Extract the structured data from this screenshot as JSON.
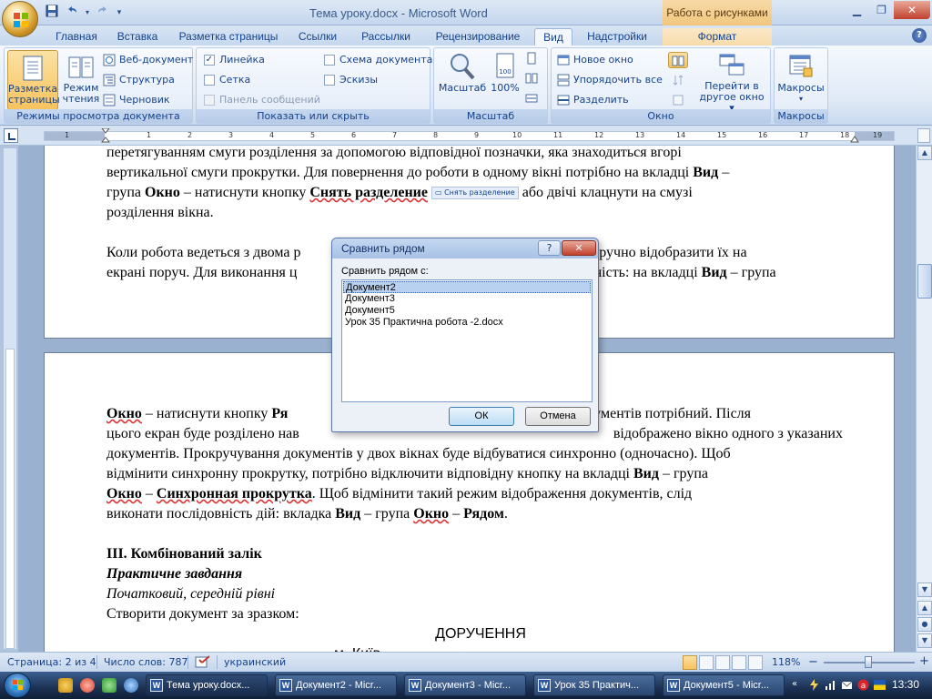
{
  "window": {
    "title": "Тема уроку.docx - Microsoft Word",
    "context_tab_title": "Работа с рисунками"
  },
  "tabs": [
    "Главная",
    "Вставка",
    "Разметка страницы",
    "Ссылки",
    "Рассылки",
    "Рецензирование",
    "Вид",
    "Надстройки",
    "Формат"
  ],
  "active_tab": "Вид",
  "ribbon": {
    "groups": {
      "views": {
        "label": "Режимы просмотра документа",
        "print_layout": "Разметка\nстраницы",
        "print_layout_l1": "Разметка",
        "print_layout_l2": "страницы",
        "reading_l1": "Режим",
        "reading_l2": "чтения",
        "web": "Веб-документ",
        "outline": "Структура",
        "draft": "Черновик"
      },
      "show_hide": {
        "label": "Показать или скрыть",
        "ruler": "Линейка",
        "ruler_checked": true,
        "doc_map": "Схема документа",
        "grid": "Сетка",
        "thumbnails": "Эскизы",
        "message_bar": "Панель сообщений"
      },
      "zoom": {
        "label": "Масштаб",
        "zoom": "Масштаб",
        "percent": "100%",
        "percent_icon": "100"
      },
      "window": {
        "label": "Окно",
        "new_window": "Новое окно",
        "arrange_all": "Упорядочить все",
        "split": "Разделить",
        "switch_l1": "Перейти в",
        "switch_l2": "другое окно"
      },
      "macros": {
        "label": "Макросы",
        "macros": "Макросы"
      }
    }
  },
  "ruler_numbers": [
    "1",
    "1",
    "2",
    "3",
    "4",
    "5",
    "6",
    "7",
    "8",
    "9",
    "10",
    "11",
    "12",
    "13",
    "14",
    "15",
    "16",
    "17",
    "18",
    "19"
  ],
  "document": {
    "page1": {
      "l1": "перетягуванням смуги розділення за допомогою відповідної позначки, яка знаходиться вгорі",
      "l2_a": "вертикальної смуги прокрутки. Для повернення до роботи в одному вікні потрібно на вкладці ",
      "l2_b": "Вид",
      "l2_c": " –",
      "l3_a": "група ",
      "l3_b": "Окно",
      "l3_c": " – натиснути кнопку ",
      "l3_d": "Снять разделение",
      "l3_btn": "Снять разделение",
      "l3_e": " або двічі клацнути на смузі",
      "l4": "розділення вікна.",
      "l5": "Коли робота ведеться з двома р",
      "l5_tail": "кумента, зручно відобразити їх на",
      "l6": "екрані поруч. Для виконання ц",
      "l6_tail_a": "ідовність: на вкладці ",
      "l6_tail_b": "Вид",
      "l6_tail_c": " – група"
    },
    "page2": {
      "l1_a": "Окно",
      "l1_b": " – натиснути кнопку ",
      "l1_c": "Ря",
      "l1_tail": "итих документів потрібний. Після",
      "l2": "цього екран буде розділено нав",
      "l2_tail": "відображено вікно одного з указаних",
      "l3": "документів. Прокручування документів у двох вікнах буде відбуватися синхронно (одночасно). Щоб",
      "l4_a": "відмінити синхронну прокрутку, потрібно відключити відповідну кнопку на вкладці ",
      "l4_b": "Вид",
      "l4_c": " – група",
      "l5_a": "Окно",
      "l5_b": " – ",
      "l5_c": "Синхронная прокрутка",
      "l5_d": ". Щоб відмінити такий режим відображення документів, слід",
      "l6_a": "виконати послідовність дій: вкладка ",
      "l6_b": "Вид",
      "l6_c": "  – група ",
      "l6_d": "Окно",
      "l6_e": " – ",
      "l6_f": "Рядом",
      "l6_g": ".",
      "h1": "III. Комбінований залік",
      "h2": "Практичне завдання",
      "h3": "Початковий, середній рівні",
      "p1": "Створити документ за зразком:",
      "center1": "ДОРУЧЕННЯ",
      "center2": "м. Київ"
    }
  },
  "dialog": {
    "title": "Сравнить рядом",
    "help": "?",
    "close": "✕",
    "label": "Сравнить рядом с:",
    "items": [
      "Документ2",
      "Документ3",
      "Документ5",
      "Урок 35 Практична робота -2.docx"
    ],
    "selected_index": 0,
    "ok": "ОК",
    "cancel": "Отмена"
  },
  "statusbar": {
    "page": "Страница: 2 из 4",
    "words": "Число слов: 787",
    "language": "украинский",
    "zoom": "118%",
    "zoom_minus": "−",
    "zoom_plus": "+"
  },
  "taskbar": {
    "items": [
      "Тема уроку.docx...",
      "Документ2 - Micr...",
      "Документ3 - Micr...",
      "Урок 35 Практич...",
      "Документ5 - Micr..."
    ],
    "active_index": 0,
    "clock": "13:30",
    "lang": "UK"
  },
  "colors": {
    "ribbon_blue": "#15428b",
    "context_orange": "#f2c77e",
    "taskbar": "#1c3154"
  },
  "icons": {
    "office_button": "office-logo-icon",
    "save": "save-icon",
    "undo": "undo-icon",
    "redo": "redo-icon"
  }
}
